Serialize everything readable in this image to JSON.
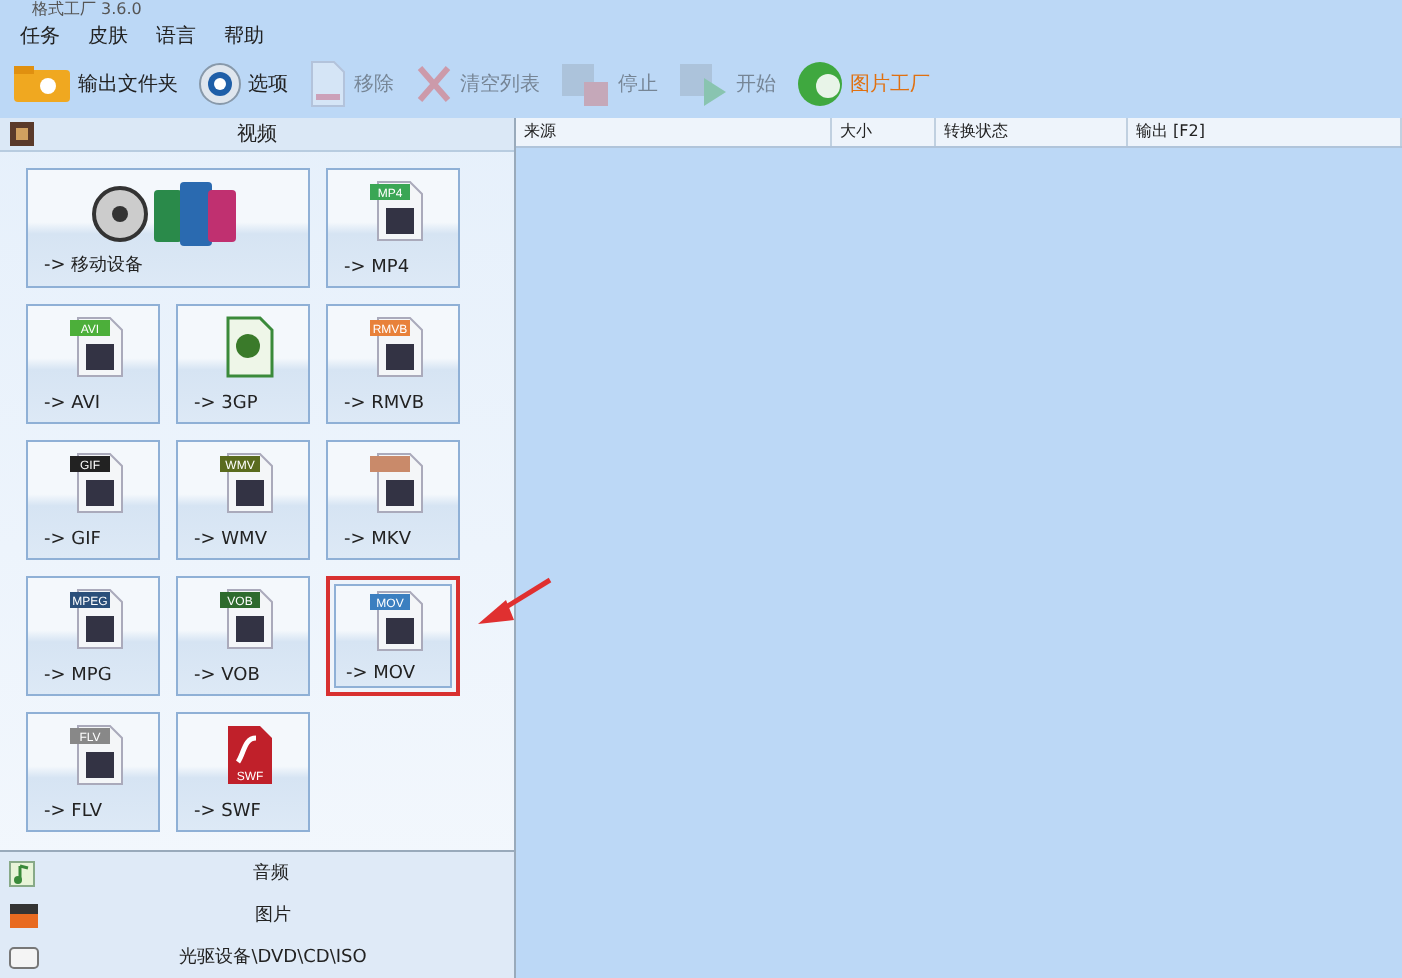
{
  "window": {
    "title": "格式工厂 3.6.0"
  },
  "menu": [
    "任务",
    "皮肤",
    "语言",
    "帮助"
  ],
  "toolbar": [
    {
      "label": "输出文件夹",
      "kind": "folder",
      "disabled": false
    },
    {
      "label": "选项",
      "kind": "gear",
      "disabled": false
    },
    {
      "label": "移除",
      "kind": "remove",
      "disabled": true
    },
    {
      "label": "清空列表",
      "kind": "clear",
      "disabled": true
    },
    {
      "label": "停止",
      "kind": "stop",
      "disabled": true
    },
    {
      "label": "开始",
      "kind": "start",
      "disabled": true
    },
    {
      "label": "图片工厂",
      "kind": "globe",
      "disabled": false
    }
  ],
  "sidebar": {
    "section": "视频",
    "tiles": [
      {
        "label": "-> 移动设备",
        "kind": "devices",
        "highlighted": false
      },
      {
        "label": "-> MP4",
        "kind": "file",
        "badge": "MP4",
        "color": "#3aa655",
        "highlighted": false
      },
      {
        "label": "-> AVI",
        "kind": "file",
        "badge": "AVI",
        "color": "#4caf3a",
        "highlighted": false
      },
      {
        "label": "-> 3GP",
        "kind": "green-file",
        "highlighted": false
      },
      {
        "label": "-> RMVB",
        "kind": "file",
        "badge": "RMVB",
        "color": "#e8813a",
        "highlighted": false
      },
      {
        "label": "-> GIF",
        "kind": "file",
        "badge": "GIF",
        "color": "#222222",
        "highlighted": false
      },
      {
        "label": "-> WMV",
        "kind": "file",
        "badge": "WMV",
        "color": "#5a6b1e",
        "highlighted": false
      },
      {
        "label": "-> MKV",
        "kind": "file",
        "color": "#c98a6a",
        "highlighted": false
      },
      {
        "label": "-> MPG",
        "kind": "file",
        "badge": "MPEG",
        "color": "#2b4f7a",
        "highlighted": false
      },
      {
        "label": "-> VOB",
        "kind": "file",
        "badge": "VOB",
        "color": "#2e6b2e",
        "highlighted": false
      },
      {
        "label": "-> MOV",
        "kind": "file",
        "badge": "MOV",
        "color": "#3b7fc0",
        "highlighted": true
      },
      {
        "label": "-> FLV",
        "kind": "file",
        "badge": "FLV",
        "color": "#888888",
        "highlighted": false
      },
      {
        "label": "-> SWF",
        "kind": "flash",
        "badge": "SWF",
        "highlighted": false
      }
    ],
    "categories": [
      {
        "label": "音频",
        "kind": "music"
      },
      {
        "label": "图片",
        "kind": "picture"
      },
      {
        "label": "光驱设备\\DVD\\CD\\ISO",
        "kind": "disc"
      }
    ]
  },
  "table": {
    "columns": [
      "来源",
      "大小",
      "转换状态",
      "输出 [F2]"
    ]
  }
}
